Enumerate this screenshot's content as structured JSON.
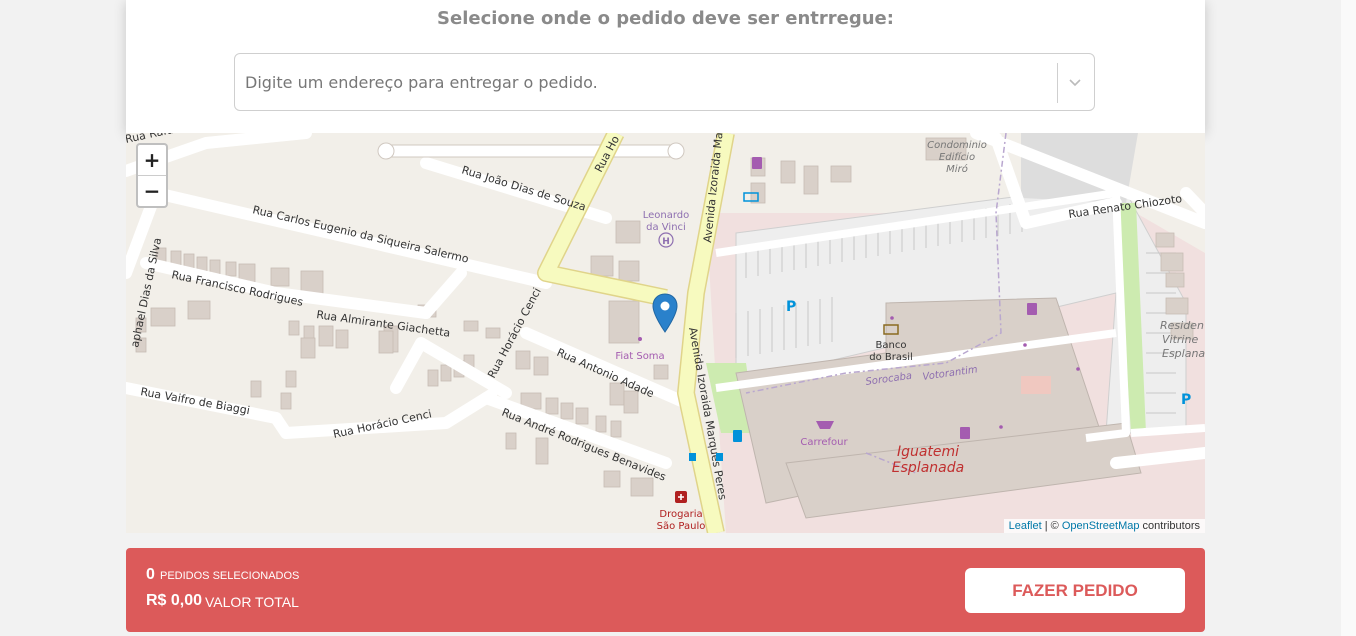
{
  "delivery": {
    "heading": "Selecione onde o pedido deve ser entrregue:",
    "address_placeholder": "Digite um endereço para entregar o pedido."
  },
  "map": {
    "zoom_in": "+",
    "zoom_out": "−",
    "attribution": {
      "leaflet": "Leaflet",
      "separator": " | © ",
      "osm": "OpenStreetMap",
      "suffix": " contributors"
    },
    "labels": {
      "rua_rafael": "Rua Rafael",
      "rua_horacio_top": "Rua Ho",
      "rua_joao_dias": "Rua João Dias de Souza",
      "rua_carlos": "Rua Carlos Eugenio da Siqueira Salermo",
      "rua_francisco": "Rua Francisco Rodrigues",
      "rua_almirante": "Rua Almirante Giachetta",
      "raphael_dias": "aphael Dias da Silva",
      "rua_horacio_cenci_v": "Rua Horácio Cenci",
      "rua_antonio": "Rua Antonio Adade",
      "rua_vaifro": "Rua Vaifro de Biaggi",
      "rua_horacio_cenci": "Rua Horácio Cenci",
      "rua_andre": "Rua André Rodrigues Benavides",
      "av_izoraida_top": "Avenida Izoraida Mar",
      "av_izoraida": "Avenida Izoraida Marques Peres",
      "leonardo_1": "Leonardo",
      "leonardo_2": "da Vinci",
      "fiat": "Fiat Soma",
      "drogaria_1": "Drogaria",
      "drogaria_2": "São Paulo",
      "condominio_1": "Condominio",
      "condominio_2": "Edifício",
      "condominio_3": "Miró",
      "rua_renato": "Rua Renato Chiozoto",
      "banco_1": "Banco",
      "banco_2": "do Brasil",
      "sorocaba": "Sorocaba",
      "votorantim": "Votorantim",
      "carrefour": "Carrefour",
      "iguatemi_1": "Iguatemi",
      "iguatemi_2": "Esplanada",
      "residencial_1": "Residen",
      "residencial_2": "Vitrine",
      "residencial_3": "Esplanad",
      "parking": "P"
    }
  },
  "footer": {
    "count": "0",
    "count_label": "Pedidos selecionados",
    "total": "R$ 0,00",
    "total_label": "Valor total",
    "order_button": "FAZER PEDIDO"
  },
  "colors": {
    "accent": "#dc5a5a",
    "map_land": "#f2efe9",
    "road_primary": "#f7fabf",
    "building": "#d9d0c9",
    "mall": "#dfd5d0",
    "marker": "#2a81cb"
  }
}
